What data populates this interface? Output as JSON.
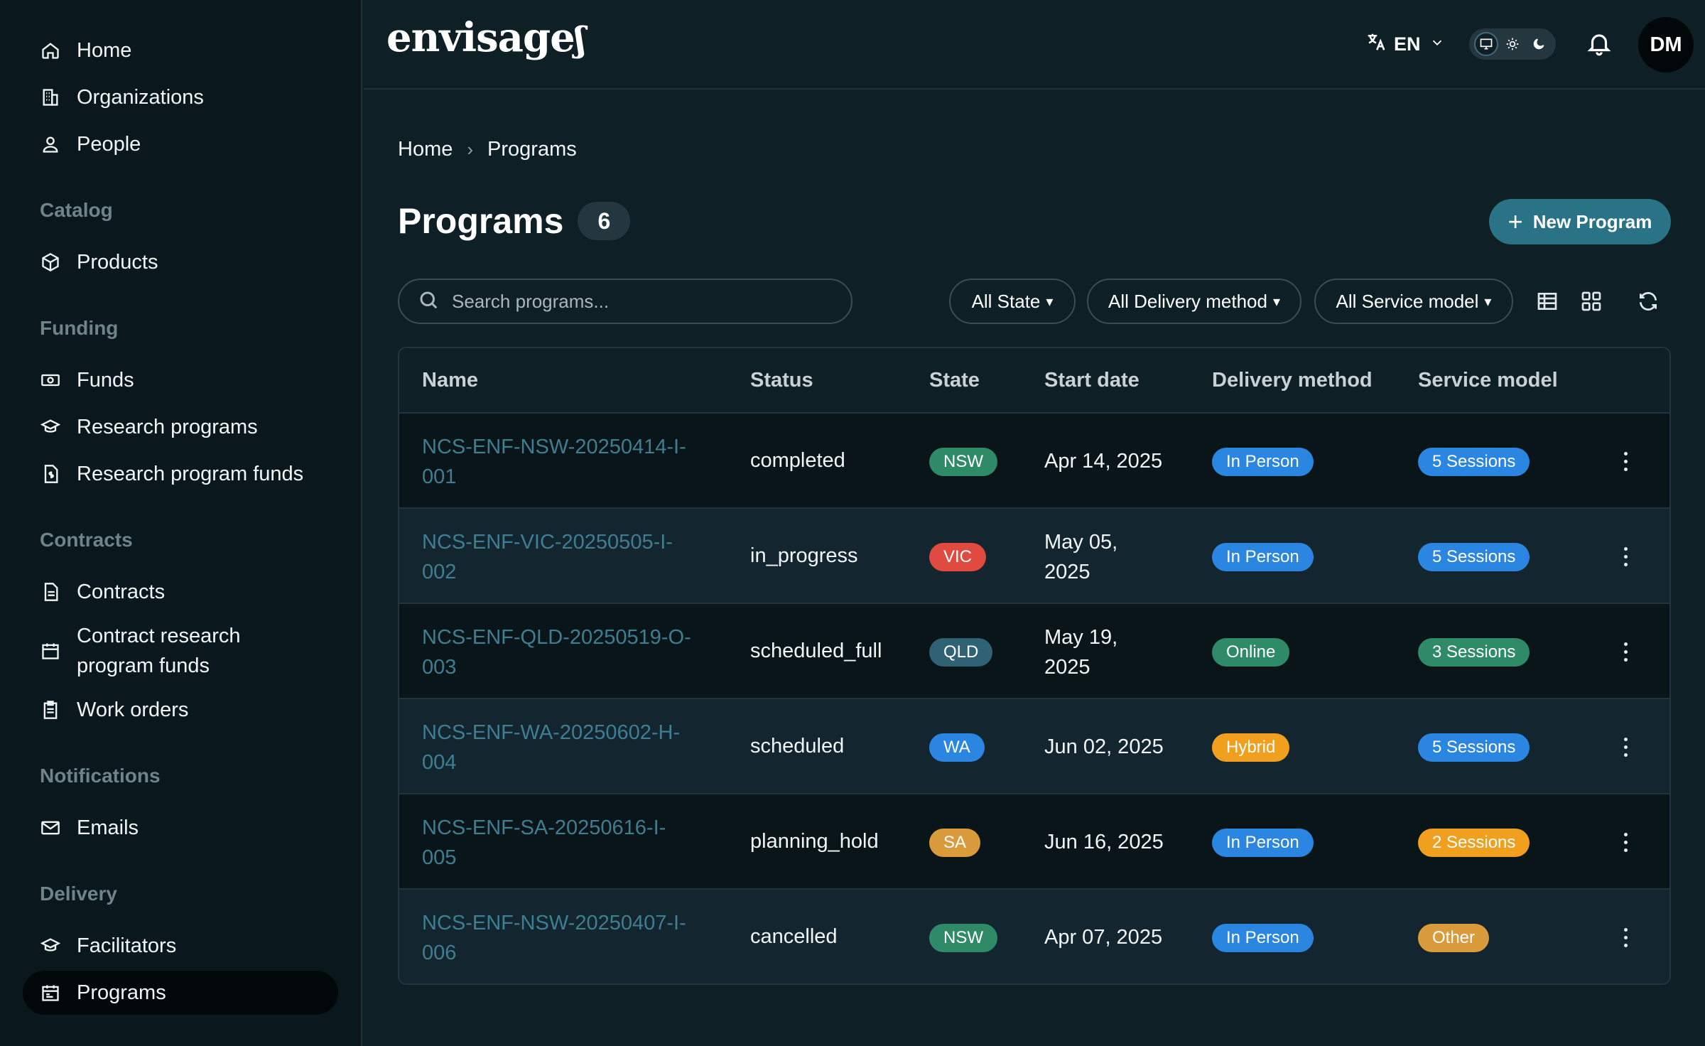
{
  "sidebar": {
    "top_items": [
      {
        "label": "Home",
        "icon": "home-icon"
      },
      {
        "label": "Organizations",
        "icon": "building-icon"
      },
      {
        "label": "People",
        "icon": "person-icon"
      }
    ],
    "sections": [
      {
        "label": "Catalog",
        "items": [
          {
            "label": "Products",
            "icon": "box-icon"
          }
        ]
      },
      {
        "label": "Funding",
        "items": [
          {
            "label": "Funds",
            "icon": "banknote-icon"
          },
          {
            "label": "Research programs",
            "icon": "graduation-cap-icon"
          },
          {
            "label": "Research program funds",
            "icon": "dollar-file-icon"
          }
        ]
      },
      {
        "label": "Contracts",
        "items": [
          {
            "label": "Contracts",
            "icon": "file-icon"
          },
          {
            "label": "Contract research program funds",
            "icon": "calendar-dollar-icon"
          },
          {
            "label": "Work orders",
            "icon": "clipboard-icon"
          }
        ]
      },
      {
        "label": "Notifications",
        "items": [
          {
            "label": "Emails",
            "icon": "mail-icon"
          }
        ]
      },
      {
        "label": "Delivery",
        "items": [
          {
            "label": "Facilitators",
            "icon": "graduation-cap-icon"
          },
          {
            "label": "Programs",
            "icon": "calendar-icon",
            "active": true
          }
        ]
      }
    ]
  },
  "header": {
    "logo": "envisage",
    "language": "EN",
    "avatar_initials": "DM"
  },
  "breadcrumb": {
    "home": "Home",
    "current": "Programs"
  },
  "page": {
    "title": "Programs",
    "count": "6",
    "new_button": "New Program"
  },
  "search": {
    "placeholder": "Search programs...",
    "value": ""
  },
  "filters": {
    "state": "All State",
    "delivery": "All Delivery method",
    "service": "All Service model"
  },
  "table": {
    "headers": {
      "name": "Name",
      "status": "Status",
      "state": "State",
      "start_date": "Start date",
      "delivery": "Delivery method",
      "service": "Service model"
    },
    "rows": [
      {
        "name1": "NCS-ENF-NSW-20250414-I-",
        "name2": "001",
        "status": "completed",
        "state": "NSW",
        "date1": "Apr 14, 2025",
        "date2": "",
        "delivery": "In Person",
        "service": "5 Sessions"
      },
      {
        "name1": "NCS-ENF-VIC-20250505-I-",
        "name2": "002",
        "status": "in_progress",
        "state": "VIC",
        "date1": "May 05,",
        "date2": "2025",
        "delivery": "In Person",
        "service": "5 Sessions"
      },
      {
        "name1": "NCS-ENF-QLD-20250519-O-",
        "name2": "003",
        "status": "scheduled_full",
        "state": "QLD",
        "date1": "May 19,",
        "date2": "2025",
        "delivery": "Online",
        "service": "3 Sessions"
      },
      {
        "name1": "NCS-ENF-WA-20250602-H-",
        "name2": "004",
        "status": "scheduled",
        "state": "WA",
        "date1": "Jun 02, 2025",
        "date2": "",
        "delivery": "Hybrid",
        "service": "5 Sessions"
      },
      {
        "name1": "NCS-ENF-SA-20250616-I-",
        "name2": "005",
        "status": "planning_hold",
        "state": "SA",
        "date1": "Jun 16, 2025",
        "date2": "",
        "delivery": "In Person",
        "service": "2 Sessions"
      },
      {
        "name1": "NCS-ENF-NSW-20250407-I-",
        "name2": "006",
        "status": "cancelled",
        "state": "NSW",
        "date1": "Apr 07, 2025",
        "date2": "",
        "delivery": "In Person",
        "service": "Other"
      }
    ]
  },
  "colors": {
    "green": "#2f8a67",
    "red": "#e04a3f",
    "teal": "#2e6274",
    "blue": "#2a86e0",
    "orange": "#f0a01e",
    "amber": "#d99b3c"
  }
}
